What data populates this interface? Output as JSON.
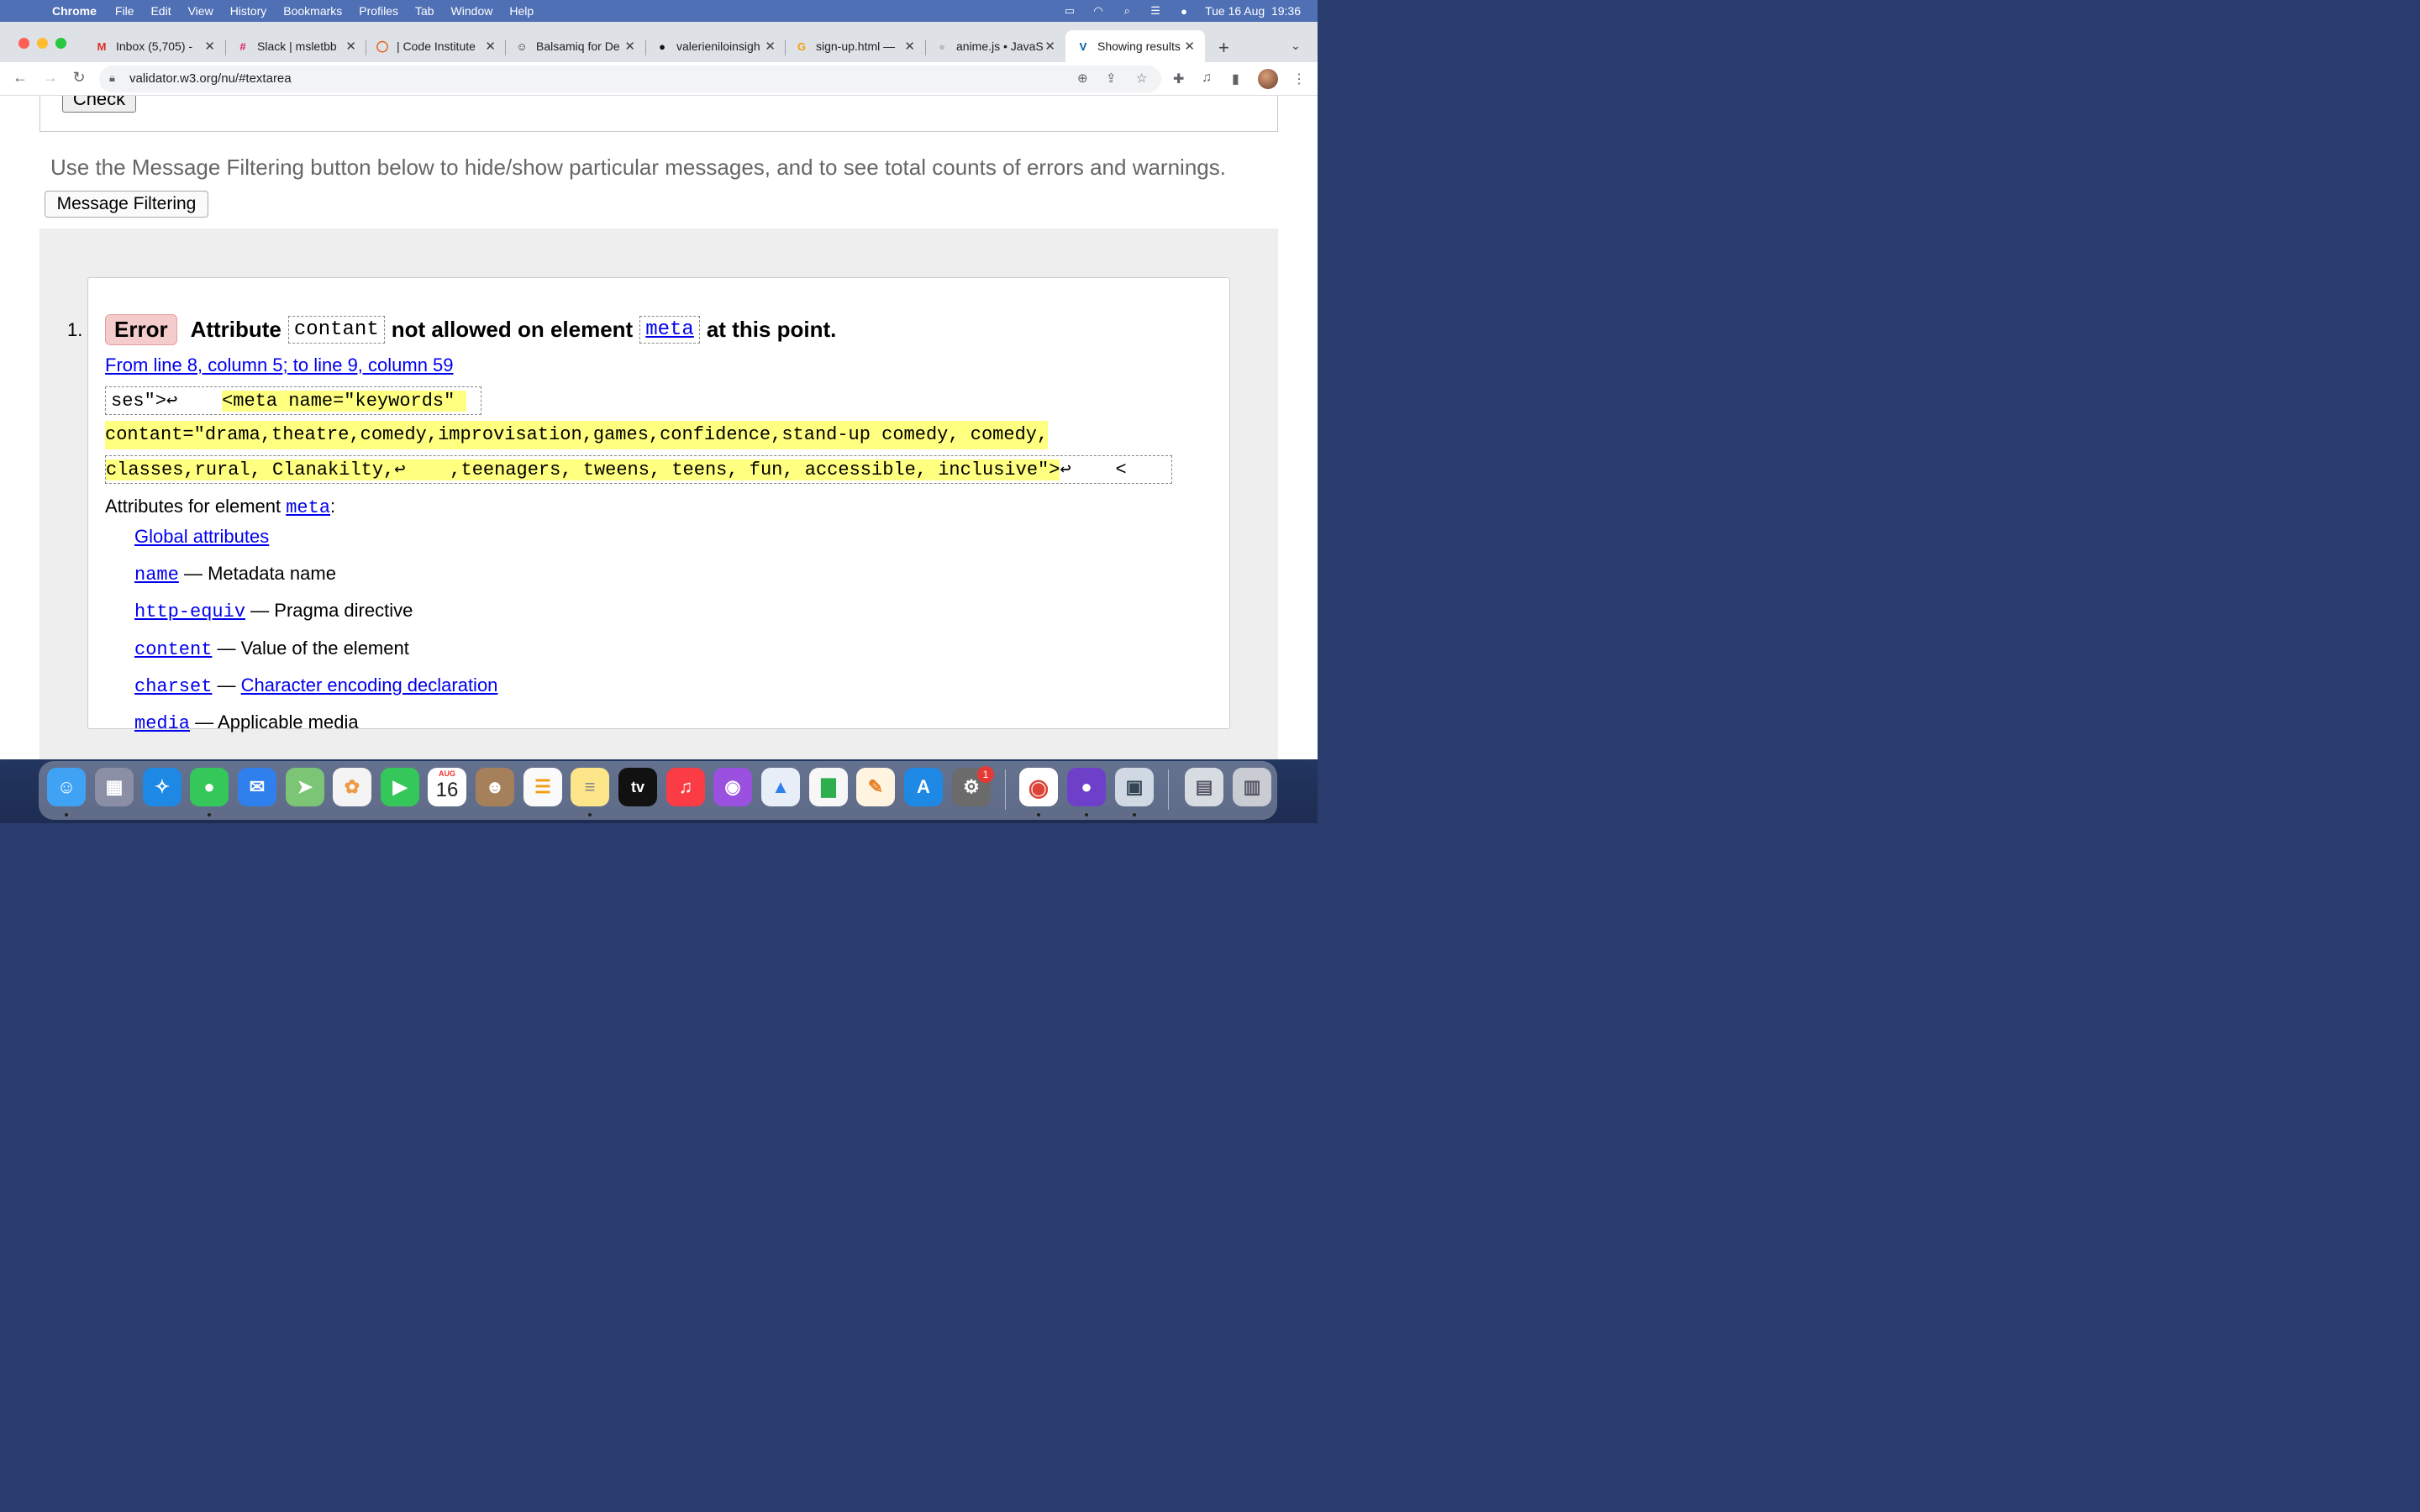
{
  "menubar": {
    "app": "Chrome",
    "items": [
      "File",
      "Edit",
      "View",
      "History",
      "Bookmarks",
      "Profiles",
      "Tab",
      "Window",
      "Help"
    ],
    "clock": "Tue 16 Aug  19:36"
  },
  "tabs": [
    {
      "title": "Inbox (5,705) -",
      "icon": "gmail-icon"
    },
    {
      "title": "Slack | msletbb",
      "icon": "slack-icon"
    },
    {
      "title": "| Code Institute",
      "icon": "code-institute-icon"
    },
    {
      "title": "Balsamiq for De",
      "icon": "balsamiq-icon"
    },
    {
      "title": "valerieniloinsigh",
      "icon": "github-icon"
    },
    {
      "title": "sign-up.html —",
      "icon": "gitpod-icon"
    },
    {
      "title": "anime.js • JavaS",
      "icon": "animejs-icon"
    },
    {
      "title": "Showing results",
      "icon": "w3c-icon"
    }
  ],
  "url": "validator.w3.org/nu/#textarea",
  "page": {
    "check_label": "Check",
    "filter_note": "Use the Message Filtering button below to hide/show particular messages, and to see total counts of errors and warnings.",
    "filter_button": "Message Filtering",
    "message": {
      "number": "1.",
      "badge": "Error",
      "t1": "Attribute",
      "attr": "contant",
      "t2": "not allowed on element",
      "element": "meta",
      "t3": "at this point.",
      "location": "From line 8, column 5; to line 9, column 59",
      "extract": {
        "l1_pre": "ses\">↩    ",
        "l1_hl": "<meta name=\"keywords\" ",
        "l2_hl": "contant=\"drama,theatre,comedy,improvisation,games,confidence,stand-up comedy, comedy,",
        "l3_hl": "classes,rural, Clanakilty,↩    ,teenagers, tweens, teens, fun, accessible, inclusive\">",
        "l3_post": "↩    <"
      },
      "attrs_head_pre": "Attributes for element ",
      "attrs_head_el": "meta",
      "attrs_head_post": ":",
      "global_attributes": "Global attributes",
      "attributes": [
        {
          "name": "name",
          "desc": "Metadata name"
        },
        {
          "name": "http-equiv",
          "desc": "Pragma directive"
        },
        {
          "name": "content",
          "desc": "Value of the element"
        },
        {
          "name": "charset",
          "desc": "Character encoding declaration"
        },
        {
          "name": "media",
          "desc": "Applicable media"
        }
      ],
      "separator": "—"
    }
  },
  "dock": {
    "calendar_month": "AUG",
    "calendar_day": "16",
    "settings_badge": "1",
    "tv_label": "tv"
  }
}
